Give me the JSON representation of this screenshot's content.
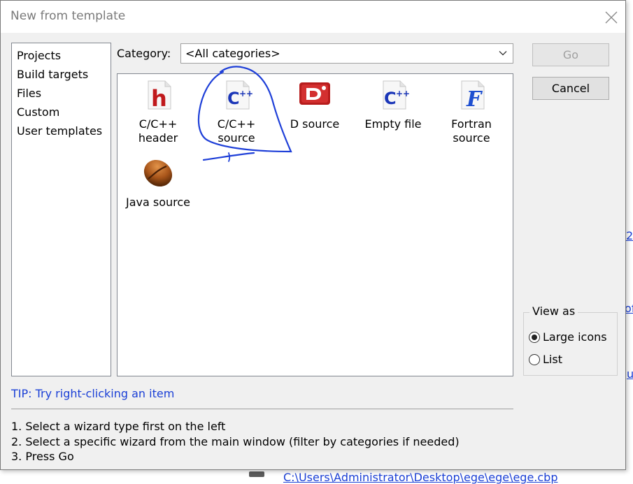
{
  "dialog": {
    "title": "New from template"
  },
  "sidebar": {
    "items": [
      {
        "label": "Projects"
      },
      {
        "label": "Build targets"
      },
      {
        "label": "Files"
      },
      {
        "label": "Custom"
      },
      {
        "label": "User templates"
      }
    ]
  },
  "category": {
    "label": "Category:",
    "selected": "<All categories>"
  },
  "templates": [
    {
      "label_line1": "C/C++",
      "label_line2": "header",
      "icon": "c-header-icon"
    },
    {
      "label_line1": "C/C++",
      "label_line2": "source",
      "icon": "cpp-source-icon"
    },
    {
      "label_line1": "D source",
      "label_line2": "",
      "icon": "d-source-icon"
    },
    {
      "label_line1": "Empty file",
      "label_line2": "",
      "icon": "empty-file-icon"
    },
    {
      "label_line1": "Fortran",
      "label_line2": "source",
      "icon": "fortran-source-icon"
    },
    {
      "label_line1": "Java source",
      "label_line2": "",
      "icon": "java-source-icon"
    }
  ],
  "buttons": {
    "go": "Go",
    "cancel": "Cancel"
  },
  "view_as": {
    "legend": "View as",
    "options": [
      {
        "label": "Large icons",
        "selected": true
      },
      {
        "label": "List",
        "selected": false
      }
    ]
  },
  "tip": "TIP: Try right-clicking an item",
  "instructions": [
    "1. Select a wizard type first on the left",
    "2. Select a specific wizard from the main window (filter by categories if needed)",
    "3. Press Go"
  ],
  "background": {
    "link_fragments": [
      "2",
      "of",
      "u"
    ],
    "path": "C:\\Users\\Administrator\\Desktop\\ege\\ege\\ege.cbp"
  },
  "colors": {
    "link_blue": "#1a3fd6",
    "dialog_bg": "#f0f0f0",
    "annotation_ink": "#1e3fd8"
  }
}
